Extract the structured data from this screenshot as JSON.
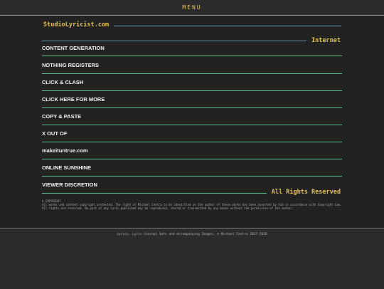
{
  "header": {
    "menu_label": "MENU"
  },
  "site": {
    "title": "StudioLyricist.com"
  },
  "sections": {
    "internet": "Internet",
    "rights": "All Rights Reserved"
  },
  "nav": {
    "items": [
      {
        "label": "CONTENT GENERATION"
      },
      {
        "label": "NOTHING REGISTERS"
      },
      {
        "label": "CLICK & CLASH"
      },
      {
        "label": "CLICK HERE FOR MORE"
      },
      {
        "label": "COPY & PASTE"
      },
      {
        "label": "X OUT OF"
      },
      {
        "label": "makeituntrue.com"
      },
      {
        "label": "ONLINE SUNSHINE"
      },
      {
        "label": "VIEWER DISCRETION"
      }
    ]
  },
  "copyright": {
    "heading": "© COPYRIGHT",
    "body": "All works and content copyright protected. The right of Michael Centra to be identified as the author of these works has been asserted by him in accordance with Copyright Law. All rights are reserved. No part of any lyric published may be reproduced, stored or transmitted by any means without the permission of the author."
  },
  "footer": {
    "text": "Lyrics, Lyric Concept Sets and Accompanying Images, © Michael Centra 2017-2020"
  },
  "colors": {
    "accent": "#e2c15a",
    "line_teal": "#5f9cab",
    "line_green": "#5fbf8a",
    "background": "#2b2b2b"
  }
}
